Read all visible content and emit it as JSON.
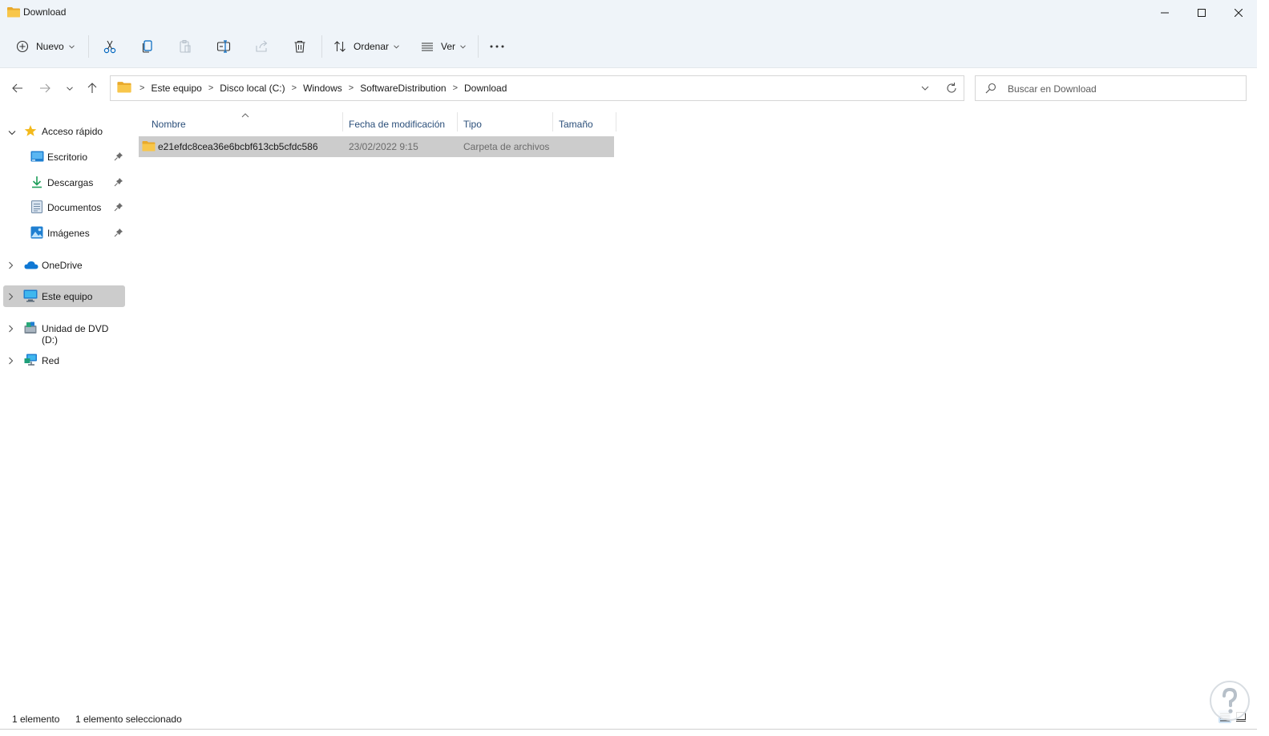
{
  "window": {
    "title": "Download"
  },
  "toolbar": {
    "new_label": "Nuevo",
    "sort_label": "Ordenar",
    "view_label": "Ver"
  },
  "address": {
    "crumbs": [
      "Este equipo",
      "Disco local (C:)",
      "Windows",
      "SoftwareDistribution",
      "Download"
    ]
  },
  "search": {
    "placeholder": "Buscar en Download"
  },
  "sidebar": {
    "items": [
      {
        "label": "Acceso rápido"
      },
      {
        "label": "Escritorio"
      },
      {
        "label": "Descargas"
      },
      {
        "label": "Documentos"
      },
      {
        "label": "Imágenes"
      },
      {
        "label": "OneDrive"
      },
      {
        "label": "Este equipo"
      },
      {
        "label": "Unidad de DVD (D:)"
      },
      {
        "label": "Red"
      }
    ]
  },
  "columns": {
    "name": "Nombre",
    "date": "Fecha de modificación",
    "type": "Tipo",
    "size": "Tamaño"
  },
  "files": [
    {
      "name": "e21efdc8cea36e6bcbf613cb5cfdc586",
      "date": "23/02/2022 9:15",
      "type": "Carpeta de archivos",
      "size": ""
    }
  ],
  "status": {
    "count": "1 elemento",
    "selected": "1 elemento seleccionado"
  },
  "colors": {
    "accent": "#0067c0",
    "chrome": "#eff4f9",
    "selection": "#cccccc",
    "folder": "#f8c64a"
  }
}
